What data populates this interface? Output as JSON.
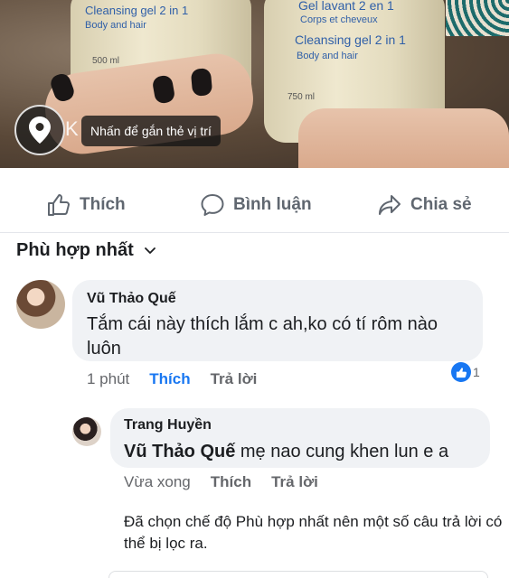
{
  "photo": {
    "bottle_left_lines": [
      "Cleansing gel 2 in 1",
      "Body and hair",
      "500 ml"
    ],
    "bottle_right_lines": [
      "Gel lavant 2 en 1",
      "Corps et cheveux",
      "Cleansing gel 2 in 1",
      "Body and hair",
      "750 ml"
    ],
    "location_tip": "Nhấn để gắn thẻ vị trí",
    "overlay_k": "K"
  },
  "actions": {
    "like": "Thích",
    "comment": "Bình luận",
    "share": "Chia sẻ"
  },
  "sort": {
    "label": "Phù hợp nhất"
  },
  "comments": [
    {
      "author": "Vũ Thảo Quế",
      "text": "Tắm cái này thích lắm c ah,ko có tí rôm nào luôn",
      "time": "1 phút",
      "like": "Thích",
      "reply": "Trả lời",
      "reactions": "1"
    }
  ],
  "reply": {
    "author": "Trang Huyền",
    "mention": "Vũ Thảo Quế",
    "text": " mẹ nao cung khen lun e a",
    "time": "Vừa xong",
    "like": "Thích",
    "reply": "Trả lời"
  },
  "notice": "Đã chọn chế độ Phù hợp nhất nên một số câu trả lời có thể bị lọc ra.",
  "colors": {
    "accent": "#1877f2",
    "bubble": "#f0f2f5",
    "muted": "#65676b"
  }
}
